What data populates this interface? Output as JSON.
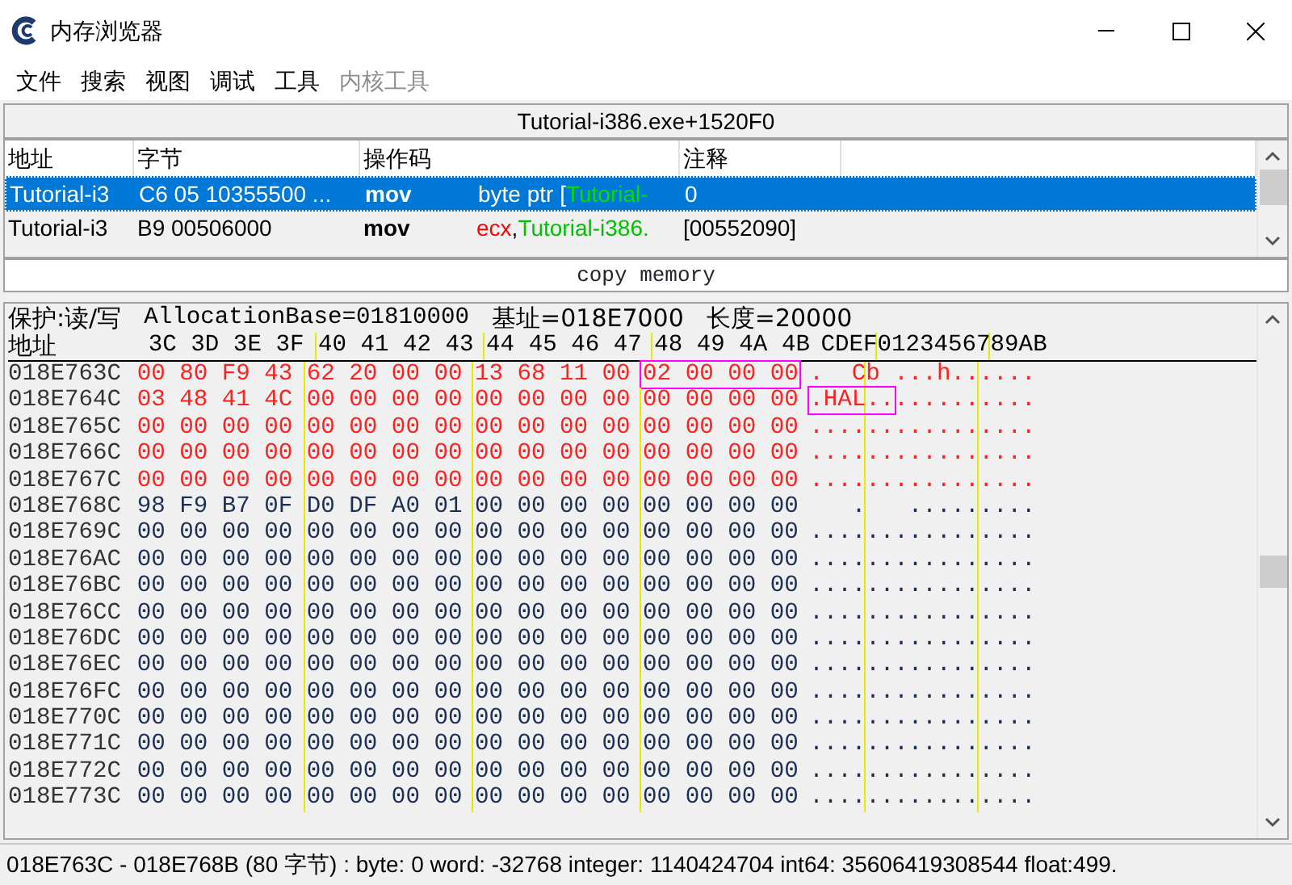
{
  "window": {
    "title": "内存浏览器"
  },
  "menu": [
    {
      "label": "文件",
      "disabled": false
    },
    {
      "label": "搜索",
      "disabled": false
    },
    {
      "label": "视图",
      "disabled": false
    },
    {
      "label": "调试",
      "disabled": false
    },
    {
      "label": "工具",
      "disabled": false
    },
    {
      "label": "内核工具",
      "disabled": true
    }
  ],
  "disassembler": {
    "location": "Tutorial-i386.exe+1520F0",
    "columns": [
      "地址",
      "字节",
      "操作码",
      "注释"
    ],
    "rows": [
      {
        "address": "Tutorial-i3",
        "bytes": "C6 05 10355500 ...",
        "opcode": "mov",
        "operand": [
          {
            "text": "byte ptr [",
            "kind": "plain"
          },
          {
            "text": "Tutorial-",
            "kind": "symbol"
          }
        ],
        "comment": "0",
        "selected": true
      },
      {
        "address": "Tutorial-i3",
        "bytes": "B9 00506000",
        "opcode": "mov",
        "operand": [
          {
            "text": "ecx",
            "kind": "register"
          },
          {
            "text": ",",
            "kind": "plain"
          },
          {
            "text": "Tutorial-i386.",
            "kind": "symbol"
          }
        ],
        "comment": "[00552090]",
        "selected": false
      }
    ],
    "copy_button": "copy memory"
  },
  "hex": {
    "info": [
      "保护:读/写",
      "AllocationBase=01810000",
      "基址=018E7000",
      "长度=20000"
    ],
    "address_header": "地址",
    "column_headers": [
      "3C 3D 3E 3F",
      "40 41 42 43",
      "44 45 46 47",
      "48 49 4A 4B"
    ],
    "ascii_header": "CDEF0123456789AB",
    "rows": [
      {
        "address": "018E763C",
        "changed": true,
        "groups": [
          {
            "bytes": [
              "00",
              "80",
              "F9",
              "43"
            ],
            "marked": false
          },
          {
            "bytes": [
              "62",
              "20",
              "00",
              "00"
            ],
            "marked": false
          },
          {
            "bytes": [
              "13",
              "68",
              "11",
              "00"
            ],
            "marked": false
          },
          {
            "bytes": [
              "02",
              "00",
              "00",
              "00"
            ],
            "marked": true
          }
        ],
        "ascii": [
          {
            "text": ".  Cb ...h......",
            "marked": false
          }
        ]
      },
      {
        "address": "018E764C",
        "changed": true,
        "groups": [
          {
            "bytes": [
              "03",
              "48",
              "41",
              "4C"
            ],
            "marked": false
          },
          {
            "bytes": [
              "00",
              "00",
              "00",
              "00"
            ],
            "marked": false
          },
          {
            "bytes": [
              "00",
              "00",
              "00",
              "00"
            ],
            "marked": false
          },
          {
            "bytes": [
              "00",
              "00",
              "00",
              "00"
            ],
            "marked": false
          }
        ],
        "ascii": [
          {
            "text": ".HAL..",
            "marked": true
          },
          {
            "text": "..........",
            "marked": false
          }
        ]
      },
      {
        "address": "018E765C",
        "changed": true,
        "groups": [
          {
            "bytes": [
              "00",
              "00",
              "00",
              "00"
            ],
            "marked": false
          },
          {
            "bytes": [
              "00",
              "00",
              "00",
              "00"
            ],
            "marked": false
          },
          {
            "bytes": [
              "00",
              "00",
              "00",
              "00"
            ],
            "marked": false
          },
          {
            "bytes": [
              "00",
              "00",
              "00",
              "00"
            ],
            "marked": false
          }
        ],
        "ascii": [
          {
            "text": "................",
            "marked": false
          }
        ]
      },
      {
        "address": "018E766C",
        "changed": true,
        "groups": [
          {
            "bytes": [
              "00",
              "00",
              "00",
              "00"
            ],
            "marked": false
          },
          {
            "bytes": [
              "00",
              "00",
              "00",
              "00"
            ],
            "marked": false
          },
          {
            "bytes": [
              "00",
              "00",
              "00",
              "00"
            ],
            "marked": false
          },
          {
            "bytes": [
              "00",
              "00",
              "00",
              "00"
            ],
            "marked": false
          }
        ],
        "ascii": [
          {
            "text": "................",
            "marked": false
          }
        ]
      },
      {
        "address": "018E767C",
        "changed": true,
        "groups": [
          {
            "bytes": [
              "00",
              "00",
              "00",
              "00"
            ],
            "marked": false
          },
          {
            "bytes": [
              "00",
              "00",
              "00",
              "00"
            ],
            "marked": false
          },
          {
            "bytes": [
              "00",
              "00",
              "00",
              "00"
            ],
            "marked": false
          },
          {
            "bytes": [
              "00",
              "00",
              "00",
              "00"
            ],
            "marked": false
          }
        ],
        "ascii": [
          {
            "text": "................",
            "marked": false
          }
        ]
      },
      {
        "address": "018E768C",
        "changed": false,
        "groups": [
          {
            "bytes": [
              "98",
              "F9",
              "B7",
              "0F"
            ],
            "marked": false
          },
          {
            "bytes": [
              "D0",
              "DF",
              "A0",
              "01"
            ],
            "marked": false
          },
          {
            "bytes": [
              "00",
              "00",
              "00",
              "00"
            ],
            "marked": false
          },
          {
            "bytes": [
              "00",
              "00",
              "00",
              "00"
            ],
            "marked": false
          }
        ],
        "ascii": [
          {
            "text": "   .   .........",
            "marked": false
          }
        ]
      },
      {
        "address": "018E769C",
        "changed": false,
        "groups": [
          {
            "bytes": [
              "00",
              "00",
              "00",
              "00"
            ],
            "marked": false
          },
          {
            "bytes": [
              "00",
              "00",
              "00",
              "00"
            ],
            "marked": false
          },
          {
            "bytes": [
              "00",
              "00",
              "00",
              "00"
            ],
            "marked": false
          },
          {
            "bytes": [
              "00",
              "00",
              "00",
              "00"
            ],
            "marked": false
          }
        ],
        "ascii": [
          {
            "text": "................",
            "marked": false
          }
        ]
      },
      {
        "address": "018E76AC",
        "changed": false,
        "groups": [
          {
            "bytes": [
              "00",
              "00",
              "00",
              "00"
            ],
            "marked": false
          },
          {
            "bytes": [
              "00",
              "00",
              "00",
              "00"
            ],
            "marked": false
          },
          {
            "bytes": [
              "00",
              "00",
              "00",
              "00"
            ],
            "marked": false
          },
          {
            "bytes": [
              "00",
              "00",
              "00",
              "00"
            ],
            "marked": false
          }
        ],
        "ascii": [
          {
            "text": "................",
            "marked": false
          }
        ]
      },
      {
        "address": "018E76BC",
        "changed": false,
        "groups": [
          {
            "bytes": [
              "00",
              "00",
              "00",
              "00"
            ],
            "marked": false
          },
          {
            "bytes": [
              "00",
              "00",
              "00",
              "00"
            ],
            "marked": false
          },
          {
            "bytes": [
              "00",
              "00",
              "00",
              "00"
            ],
            "marked": false
          },
          {
            "bytes": [
              "00",
              "00",
              "00",
              "00"
            ],
            "marked": false
          }
        ],
        "ascii": [
          {
            "text": "................",
            "marked": false
          }
        ]
      },
      {
        "address": "018E76CC",
        "changed": false,
        "groups": [
          {
            "bytes": [
              "00",
              "00",
              "00",
              "00"
            ],
            "marked": false
          },
          {
            "bytes": [
              "00",
              "00",
              "00",
              "00"
            ],
            "marked": false
          },
          {
            "bytes": [
              "00",
              "00",
              "00",
              "00"
            ],
            "marked": false
          },
          {
            "bytes": [
              "00",
              "00",
              "00",
              "00"
            ],
            "marked": false
          }
        ],
        "ascii": [
          {
            "text": "................",
            "marked": false
          }
        ]
      },
      {
        "address": "018E76DC",
        "changed": false,
        "groups": [
          {
            "bytes": [
              "00",
              "00",
              "00",
              "00"
            ],
            "marked": false
          },
          {
            "bytes": [
              "00",
              "00",
              "00",
              "00"
            ],
            "marked": false
          },
          {
            "bytes": [
              "00",
              "00",
              "00",
              "00"
            ],
            "marked": false
          },
          {
            "bytes": [
              "00",
              "00",
              "00",
              "00"
            ],
            "marked": false
          }
        ],
        "ascii": [
          {
            "text": "................",
            "marked": false
          }
        ]
      },
      {
        "address": "018E76EC",
        "changed": false,
        "groups": [
          {
            "bytes": [
              "00",
              "00",
              "00",
              "00"
            ],
            "marked": false
          },
          {
            "bytes": [
              "00",
              "00",
              "00",
              "00"
            ],
            "marked": false
          },
          {
            "bytes": [
              "00",
              "00",
              "00",
              "00"
            ],
            "marked": false
          },
          {
            "bytes": [
              "00",
              "00",
              "00",
              "00"
            ],
            "marked": false
          }
        ],
        "ascii": [
          {
            "text": "................",
            "marked": false
          }
        ]
      },
      {
        "address": "018E76FC",
        "changed": false,
        "groups": [
          {
            "bytes": [
              "00",
              "00",
              "00",
              "00"
            ],
            "marked": false
          },
          {
            "bytes": [
              "00",
              "00",
              "00",
              "00"
            ],
            "marked": false
          },
          {
            "bytes": [
              "00",
              "00",
              "00",
              "00"
            ],
            "marked": false
          },
          {
            "bytes": [
              "00",
              "00",
              "00",
              "00"
            ],
            "marked": false
          }
        ],
        "ascii": [
          {
            "text": "................",
            "marked": false
          }
        ]
      },
      {
        "address": "018E770C",
        "changed": false,
        "groups": [
          {
            "bytes": [
              "00",
              "00",
              "00",
              "00"
            ],
            "marked": false
          },
          {
            "bytes": [
              "00",
              "00",
              "00",
              "00"
            ],
            "marked": false
          },
          {
            "bytes": [
              "00",
              "00",
              "00",
              "00"
            ],
            "marked": false
          },
          {
            "bytes": [
              "00",
              "00",
              "00",
              "00"
            ],
            "marked": false
          }
        ],
        "ascii": [
          {
            "text": "................",
            "marked": false
          }
        ]
      },
      {
        "address": "018E771C",
        "changed": false,
        "groups": [
          {
            "bytes": [
              "00",
              "00",
              "00",
              "00"
            ],
            "marked": false
          },
          {
            "bytes": [
              "00",
              "00",
              "00",
              "00"
            ],
            "marked": false
          },
          {
            "bytes": [
              "00",
              "00",
              "00",
              "00"
            ],
            "marked": false
          },
          {
            "bytes": [
              "00",
              "00",
              "00",
              "00"
            ],
            "marked": false
          }
        ],
        "ascii": [
          {
            "text": "................",
            "marked": false
          }
        ]
      },
      {
        "address": "018E772C",
        "changed": false,
        "groups": [
          {
            "bytes": [
              "00",
              "00",
              "00",
              "00"
            ],
            "marked": false
          },
          {
            "bytes": [
              "00",
              "00",
              "00",
              "00"
            ],
            "marked": false
          },
          {
            "bytes": [
              "00",
              "00",
              "00",
              "00"
            ],
            "marked": false
          },
          {
            "bytes": [
              "00",
              "00",
              "00",
              "00"
            ],
            "marked": false
          }
        ],
        "ascii": [
          {
            "text": "................",
            "marked": false
          }
        ]
      },
      {
        "address": "018E773C",
        "changed": false,
        "groups": [
          {
            "bytes": [
              "00",
              "00",
              "00",
              "00"
            ],
            "marked": false
          },
          {
            "bytes": [
              "00",
              "00",
              "00",
              "00"
            ],
            "marked": false
          },
          {
            "bytes": [
              "00",
              "00",
              "00",
              "00"
            ],
            "marked": false
          },
          {
            "bytes": [
              "00",
              "00",
              "00",
              "00"
            ],
            "marked": false
          }
        ],
        "ascii": [
          {
            "text": "................",
            "marked": false
          }
        ]
      }
    ]
  },
  "status_bar": "018E763C - 018E768B (80 字节) : byte: 0 word: -32768 integer: 1140424704 int64: 35606419308544 float:499."
}
